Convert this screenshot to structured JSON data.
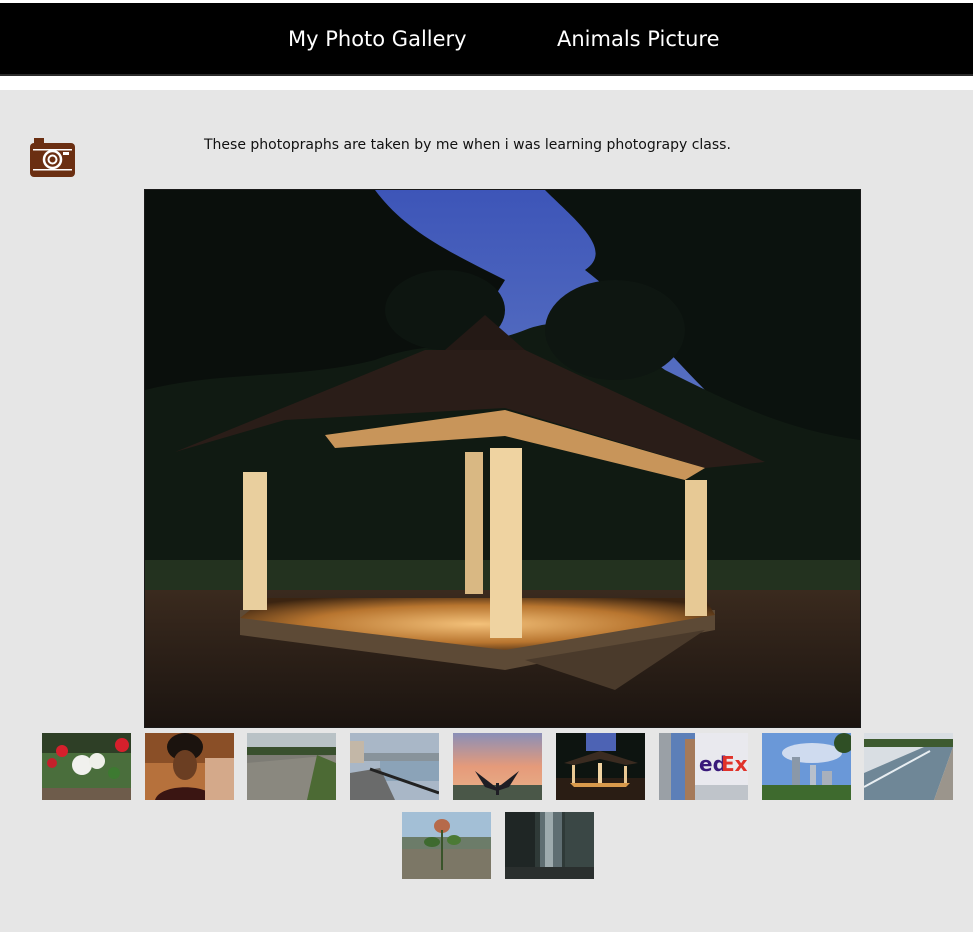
{
  "nav": {
    "links": [
      {
        "label": "My Photo Gallery"
      },
      {
        "label": "Animals Picture"
      }
    ]
  },
  "intro": {
    "text": "These photopraphs are taken by me when i was learning photograpy class.",
    "icon": "camera-icon",
    "icon_color": "#6b2f12"
  },
  "main_photo": {
    "subject": "gazebo-at-dusk",
    "selected_index": 5
  },
  "thumbnails": [
    {
      "subject": "flowers"
    },
    {
      "subject": "portrait"
    },
    {
      "subject": "rocky-riverbank"
    },
    {
      "subject": "riverside-walkway"
    },
    {
      "subject": "sunset-sculpture"
    },
    {
      "subject": "gazebo-at-dusk"
    },
    {
      "subject": "fedex-building"
    },
    {
      "subject": "city-skyline"
    },
    {
      "subject": "river-dam"
    },
    {
      "subject": "seedling"
    },
    {
      "subject": "waterfall"
    }
  ]
}
